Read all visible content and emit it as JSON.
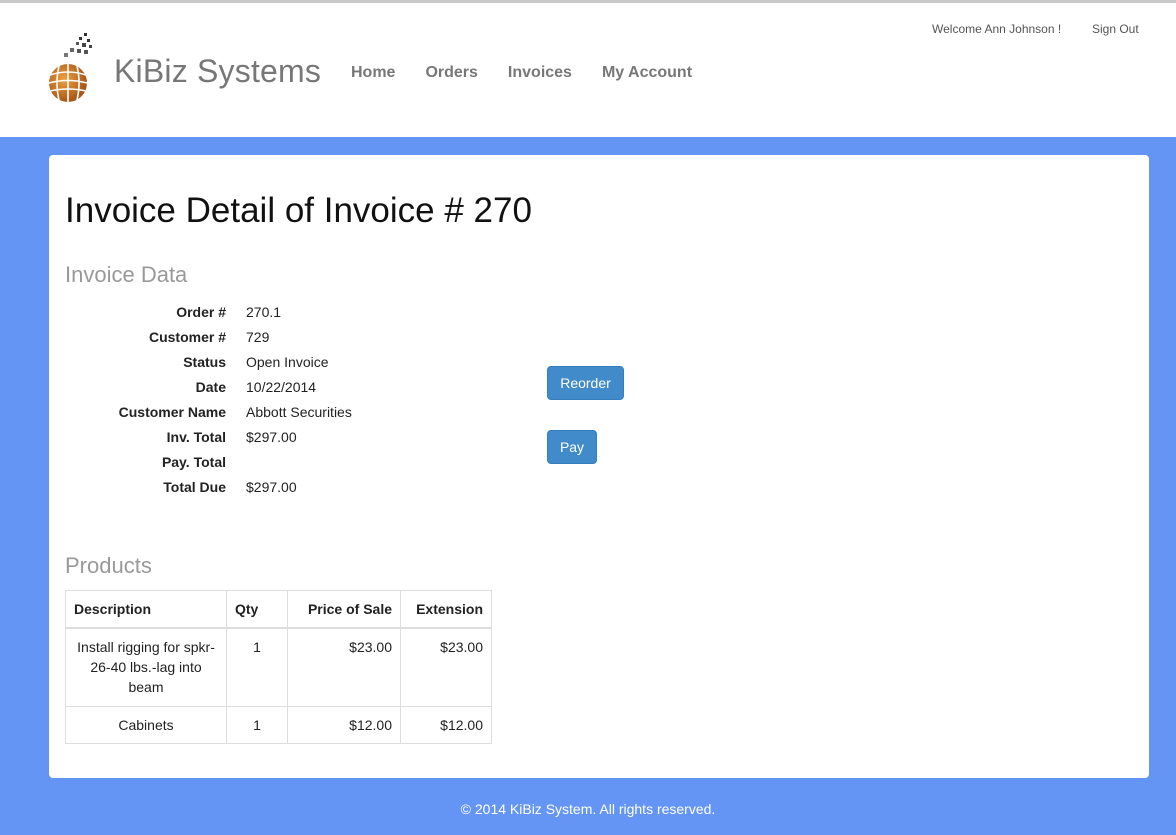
{
  "header": {
    "brand": "KiBiz Systems",
    "nav": [
      "Home",
      "Orders",
      "Invoices",
      "My Account"
    ],
    "welcome": "Welcome Ann Johnson !",
    "signout": "Sign Out"
  },
  "page": {
    "title": "Invoice Detail of Invoice # 270",
    "invoice_section": "Invoice Data",
    "products_section": "Products"
  },
  "invoice": [
    {
      "label": "Order #",
      "value": "270.1"
    },
    {
      "label": "Customer #",
      "value": "729"
    },
    {
      "label": "Status",
      "value": "Open Invoice"
    },
    {
      "label": "Date",
      "value": "10/22/2014"
    },
    {
      "label": "Customer Name",
      "value": "Abbott Securities"
    },
    {
      "label": "Inv. Total",
      "value": "$297.00"
    },
    {
      "label": "Pay. Total",
      "value": ""
    },
    {
      "label": "Total Due",
      "value": "$297.00"
    }
  ],
  "buttons": {
    "reorder": "Reorder",
    "pay": "Pay"
  },
  "products": {
    "headers": [
      "Description",
      "Qty",
      "Price of Sale",
      "Extension"
    ],
    "rows": [
      [
        "Install rigging for spkr-26-40 lbs.-lag into beam",
        "1",
        "$23.00",
        "$23.00"
      ],
      [
        "Cabinets",
        "1",
        "$12.00",
        "$12.00"
      ]
    ]
  },
  "footer": "© 2014 KiBiz System. All rights reserved.",
  "colors": {
    "background": "#6495f5",
    "button": "#428bca",
    "brand_text": "#777777",
    "section_title": "#999999"
  },
  "icons": {
    "logo": "kibiz-globe-logo"
  }
}
